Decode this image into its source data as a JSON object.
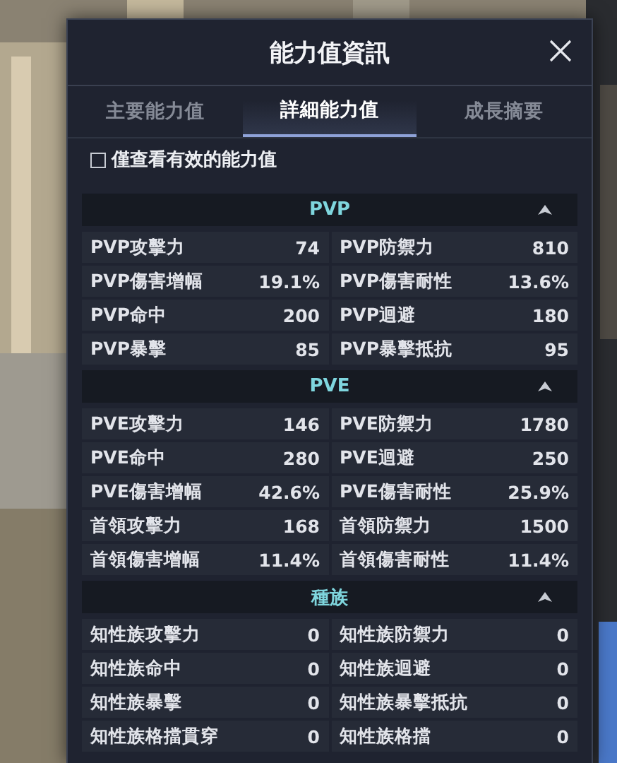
{
  "dialog": {
    "title": "能力值資訊",
    "tabs": [
      {
        "label": "主要能力值",
        "selected": false
      },
      {
        "label": "詳細能力值",
        "selected": true
      },
      {
        "label": "成長摘要",
        "selected": false
      }
    ],
    "filter": {
      "label": "僅查看有效的能力值",
      "checked": false
    },
    "sections": [
      {
        "title": "PVP",
        "expanded": true,
        "rows": [
          {
            "left": {
              "label": "PVP攻擊力",
              "value": "74"
            },
            "right": {
              "label": "PVP防禦力",
              "value": "810"
            }
          },
          {
            "left": {
              "label": "PVP傷害增幅",
              "value": "19.1%"
            },
            "right": {
              "label": "PVP傷害耐性",
              "value": "13.6%"
            }
          },
          {
            "left": {
              "label": "PVP命中",
              "value": "200"
            },
            "right": {
              "label": "PVP迴避",
              "value": "180"
            }
          },
          {
            "left": {
              "label": "PVP暴擊",
              "value": "85"
            },
            "right": {
              "label": "PVP暴擊抵抗",
              "value": "95"
            }
          }
        ]
      },
      {
        "title": "PVE",
        "expanded": true,
        "rows": [
          {
            "left": {
              "label": "PVE攻擊力",
              "value": "146"
            },
            "right": {
              "label": "PVE防禦力",
              "value": "1780"
            }
          },
          {
            "left": {
              "label": "PVE命中",
              "value": "280"
            },
            "right": {
              "label": "PVE迴避",
              "value": "250"
            }
          },
          {
            "left": {
              "label": "PVE傷害增幅",
              "value": "42.6%"
            },
            "right": {
              "label": "PVE傷害耐性",
              "value": "25.9%"
            }
          },
          {
            "left": {
              "label": "首領攻擊力",
              "value": "168"
            },
            "right": {
              "label": "首領防禦力",
              "value": "1500"
            }
          },
          {
            "left": {
              "label": "首領傷害增幅",
              "value": "11.4%"
            },
            "right": {
              "label": "首領傷害耐性",
              "value": "11.4%"
            }
          }
        ]
      },
      {
        "title": "種族",
        "expanded": true,
        "rows": [
          {
            "left": {
              "label": "知性族攻擊力",
              "value": "0"
            },
            "right": {
              "label": "知性族防禦力",
              "value": "0"
            }
          },
          {
            "left": {
              "label": "知性族命中",
              "value": "0"
            },
            "right": {
              "label": "知性族迴避",
              "value": "0"
            }
          },
          {
            "left": {
              "label": "知性族暴擊",
              "value": "0"
            },
            "right": {
              "label": "知性族暴擊抵抗",
              "value": "0"
            }
          },
          {
            "left": {
              "label": "知性族格擋貫穿",
              "value": "0"
            },
            "right": {
              "label": "知性族格擋",
              "value": "0"
            }
          }
        ]
      }
    ]
  }
}
